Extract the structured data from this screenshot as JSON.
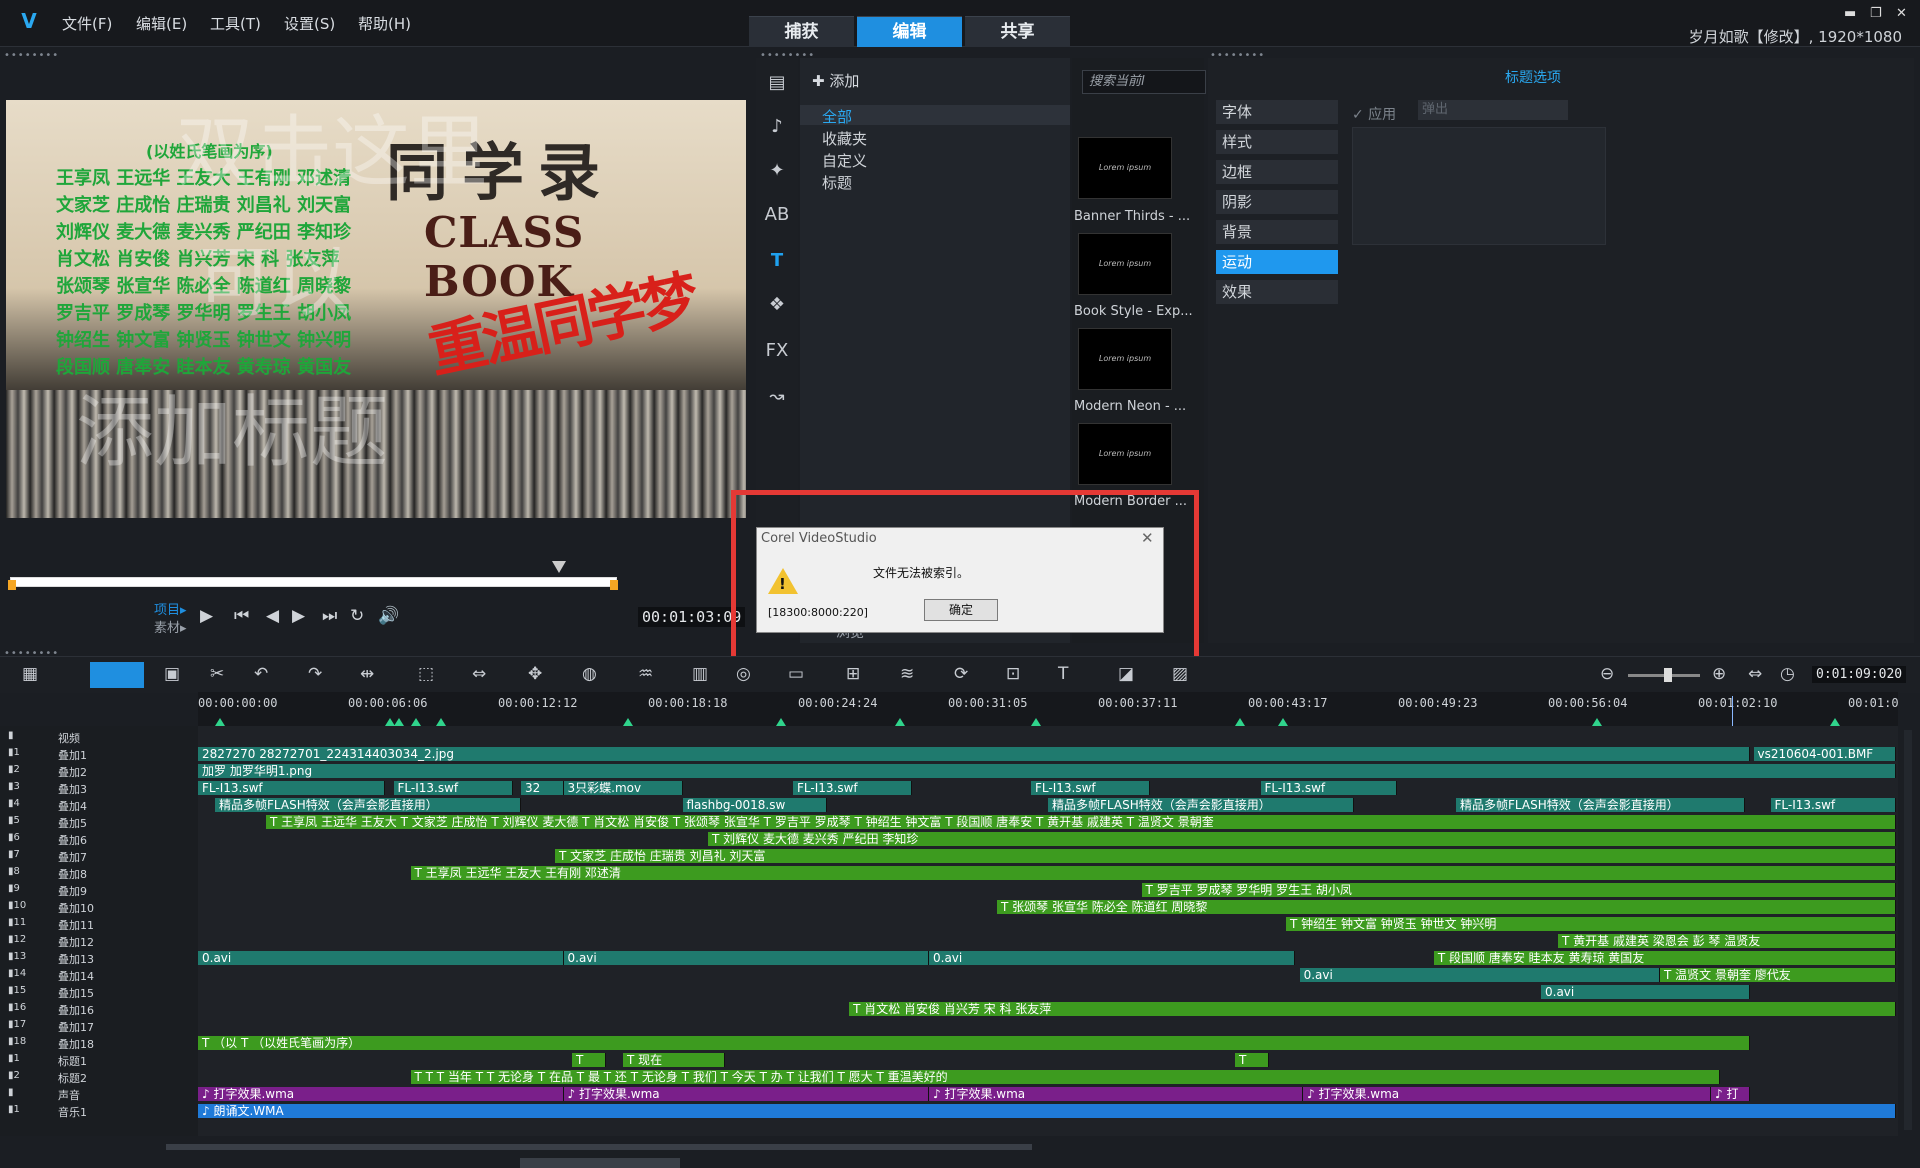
{
  "app": {
    "logo": "V",
    "menu": [
      "文件(F)",
      "编辑(E)",
      "工具(T)",
      "设置(S)",
      "帮助(H)"
    ],
    "tabs": [
      "捕获",
      "编辑",
      "共享"
    ],
    "active_tab": "编辑",
    "project_title": "岁月如歌【修改】, 1920*1080",
    "win_min": "▬",
    "win_max": "❐",
    "win_close": "✕"
  },
  "preview": {
    "scroll_title": "同学录",
    "classbook": "CLASS BOOK",
    "red_title": "重温同学梦",
    "names_header": "(以姓氏笔画为序)",
    "names": [
      "王享凤 王远华 王友大 王有刚 邓述清",
      "文家芝 庄成怡 庄瑞贵 刘昌礼 刘天富",
      "刘辉仪 麦大德 麦兴秀 严纪田 李知珍",
      "肖文松 肖安俊 肖兴芳 宋 科 张友萍",
      "张颂琴 张宣华 陈必全 陈道红 周晓黎",
      "罗吉平 罗成琴 罗华明 罗生王 胡小凤",
      "钟绍生 钟文富 钟贤玉 钟世文 钟兴明",
      "段国顺 唐奉安 眭本友 黄寿琼 黄国友"
    ],
    "watermark1": "双击这里",
    "watermark2": "可以",
    "watermark3": "添加标题",
    "project_label": "项目▸",
    "clip_label": "素材▸",
    "timecode": "00:01:03:09"
  },
  "playback": {
    "play": "▶",
    "start": "⏮",
    "prev": "◀",
    "next": "▶",
    "end": "⏭",
    "repeat": "↻",
    "volume": "🔊"
  },
  "library": {
    "add_label": "添加",
    "categories": [
      "全部",
      "收藏夹",
      "自定义",
      "标题"
    ],
    "selected_category": "全部",
    "search_placeholder": "搜索当前l",
    "thumbs": [
      {
        "caption": "Banner Thirds - ...",
        "text": "Lorem ipsum"
      },
      {
        "caption": "Book Style - Exp...",
        "text": "Lorem ipsum"
      },
      {
        "caption": "Modern Neon - ...",
        "text": "Lorem ipsum"
      },
      {
        "caption": "Modern Border ...",
        "text": "Lorem ipsum"
      }
    ],
    "tool_fx": "FX",
    "tool_title": "T",
    "tool_ab": "AB",
    "browse": "浏览"
  },
  "options": {
    "title": "标题选项",
    "items": [
      "字体",
      "样式",
      "边框",
      "阴影",
      "背景",
      "运动",
      "效果"
    ],
    "selected": "运动",
    "apply_label": "✓ 应用",
    "popup_value": "弹出"
  },
  "dialog": {
    "title": "Corel VideoStudio",
    "message": "文件无法被索引。",
    "code": "[18300:8000:220]",
    "ok_label": "确定",
    "close": "✕",
    "warn": "!"
  },
  "timeline": {
    "timecode": "0:01:09:020",
    "ticks": [
      "00:00:00:00",
      "00:00:06:06",
      "00:00:12:12",
      "00:00:18:18",
      "00:00:24:24",
      "00:00:31:05",
      "00:00:37:11",
      "00:00:43:17",
      "00:00:49:23",
      "00:00:56:04",
      "00:01:02:10",
      "00:01:0"
    ],
    "markers": [
      0.01,
      0.11,
      0.115,
      0.125,
      0.14,
      0.25,
      0.34,
      0.41,
      0.49,
      0.61,
      0.635,
      0.82,
      0.96
    ],
    "tracks": [
      "视频",
      "叠加1",
      "叠加2",
      "叠加3",
      "叠加4",
      "叠加5",
      "叠加6",
      "叠加7",
      "叠加8",
      "叠加9",
      "叠加10",
      "叠加11",
      "叠加12",
      "叠加13",
      "叠加14",
      "叠加15",
      "叠加16",
      "叠加17",
      "叠加18",
      "标题1",
      "标题2",
      "声音",
      "音乐1"
    ],
    "track_nums": [
      "",
      "1",
      "2",
      "3",
      "4",
      "5",
      "6",
      "7",
      "8",
      "9",
      "10",
      "11",
      "12",
      "13",
      "14",
      "15",
      "16",
      "17",
      "18",
      "1",
      "2",
      "",
      "1"
    ],
    "clips": [
      {
        "row": 1,
        "s": 0.0,
        "e": 0.913,
        "c": "c-teal",
        "t": "2827270  28272701_224314403034_2.jpg"
      },
      {
        "row": 1,
        "s": 0.915,
        "e": 0.999,
        "c": "c-teal",
        "t": "vs210604-001.BMF"
      },
      {
        "row": 2,
        "s": 0.0,
        "e": 0.999,
        "c": "c-teal",
        "t": "加罗  加罗华明1.png"
      },
      {
        "row": 3,
        "s": 0.0,
        "e": 0.11,
        "c": "c-teal",
        "t": "FL-I13.swf"
      },
      {
        "row": 3,
        "s": 0.115,
        "e": 0.185,
        "c": "c-teal",
        "t": "FL-I13.swf"
      },
      {
        "row": 3,
        "s": 0.19,
        "e": 0.215,
        "c": "c-teal",
        "t": "32"
      },
      {
        "row": 3,
        "s": 0.215,
        "e": 0.285,
        "c": "c-teal",
        "t": "3只彩蝶.mov"
      },
      {
        "row": 3,
        "s": 0.35,
        "e": 0.42,
        "c": "c-teal",
        "t": "FL-I13.swf"
      },
      {
        "row": 3,
        "s": 0.49,
        "e": 0.56,
        "c": "c-teal",
        "t": "FL-I13.swf"
      },
      {
        "row": 3,
        "s": 0.625,
        "e": 0.705,
        "c": "c-teal",
        "t": "FL-I13.swf"
      },
      {
        "row": 4,
        "s": 0.01,
        "e": 0.19,
        "c": "c-teal",
        "t": "精品多帧FLASH特效（会声会影直接用）"
      },
      {
        "row": 4,
        "s": 0.285,
        "e": 0.37,
        "c": "c-teal",
        "t": "flashbg-0018.sw"
      },
      {
        "row": 4,
        "s": 0.5,
        "e": 0.68,
        "c": "c-teal",
        "t": "精品多帧FLASH特效（会声会影直接用）"
      },
      {
        "row": 4,
        "s": 0.74,
        "e": 0.91,
        "c": "c-teal",
        "t": "精品多帧FLASH特效（会声会影直接用）"
      },
      {
        "row": 4,
        "s": 0.925,
        "e": 0.999,
        "c": "c-teal",
        "t": "FL-I13.swf"
      },
      {
        "row": 5,
        "s": 0.04,
        "e": 0.999,
        "c": "c-green",
        "t": "T  王享凤 王远华 王友大 T 文家芝 庄成怡  T 刘辉仪 麦大德  T 肖文松 肖安俊  T 张颂琴 张宣华  T 罗吉平 罗成琴  T 钟绍生 钟文富  T 段国顺 唐奉安  T 黄开基 戚建英  T 温贤文 景朝奎"
      },
      {
        "row": 6,
        "s": 0.3,
        "e": 0.999,
        "c": "c-green",
        "t": "T  刘辉仪 麦大德 麦兴秀 严纪田 李知珍"
      },
      {
        "row": 7,
        "s": 0.21,
        "e": 0.999,
        "c": "c-green",
        "t": "T  文家芝 庄成怡 庄瑞贵 刘昌礼 刘天富"
      },
      {
        "row": 8,
        "s": 0.125,
        "e": 0.999,
        "c": "c-green",
        "t": "T  王享凤 王远华 王友大 王有刚 邓述清"
      },
      {
        "row": 9,
        "s": 0.555,
        "e": 0.999,
        "c": "c-green",
        "t": "T  罗吉平 罗成琴 罗华明 罗生王 胡小凤"
      },
      {
        "row": 10,
        "s": 0.47,
        "e": 0.999,
        "c": "c-green",
        "t": "T  张颂琴 张宣华 陈必全 陈道红 周晓黎"
      },
      {
        "row": 11,
        "s": 0.64,
        "e": 0.999,
        "c": "c-green",
        "t": "T  钟绍生 钟文富 钟贤玉 钟世文 钟兴明"
      },
      {
        "row": 12,
        "s": 0.8,
        "e": 0.999,
        "c": "c-green",
        "t": "T  黄开基 戚建英 梁恩会 彭 琴 温贤友"
      },
      {
        "row": 13,
        "s": 0.0,
        "e": 0.215,
        "c": "c-teal",
        "t": "0.avi"
      },
      {
        "row": 13,
        "s": 0.215,
        "e": 0.43,
        "c": "c-teal",
        "t": "0.avi"
      },
      {
        "row": 13,
        "s": 0.43,
        "e": 0.645,
        "c": "c-teal",
        "t": "0.avi"
      },
      {
        "row": 13,
        "s": 0.727,
        "e": 0.999,
        "c": "c-green",
        "t": "T  段国顺 唐奉安 眭本友 黄寿琼 黄国友"
      },
      {
        "row": 14,
        "s": 0.648,
        "e": 0.86,
        "c": "c-teal",
        "t": "0.avi"
      },
      {
        "row": 14,
        "s": 0.86,
        "e": 0.999,
        "c": "c-green",
        "t": "T  温贤文 景朝奎 廖代友"
      },
      {
        "row": 15,
        "s": 0.79,
        "e": 0.913,
        "c": "c-teal",
        "t": "0.avi"
      },
      {
        "row": 16,
        "s": 0.383,
        "e": 0.999,
        "c": "c-green",
        "t": "T  肖文松 肖安俊 肖兴芳 宋 科 张友萍"
      },
      {
        "row": 18,
        "s": 0.0,
        "e": 0.913,
        "c": "c-green",
        "t": "T （以 T （以姓氏笔画为序）"
      },
      {
        "row": 19,
        "s": 0.22,
        "e": 0.24,
        "c": "c-green",
        "t": "T"
      },
      {
        "row": 19,
        "s": 0.25,
        "e": 0.31,
        "c": "c-green",
        "t": "T  现在"
      },
      {
        "row": 19,
        "s": 0.61,
        "e": 0.63,
        "c": "c-green",
        "t": "T"
      },
      {
        "row": 20,
        "s": 0.125,
        "e": 0.895,
        "c": "c-green",
        "t": "T  T  T 当年  T  T 无论身  T 在品  T 最  T 还  T 无论身  T 我们  T 今天  T 办  T 让我们  T 愿大  T 重温美好的"
      },
      {
        "row": 21,
        "s": 0.0,
        "e": 0.215,
        "c": "c-purple",
        "t": "♪ 打字效果.wma"
      },
      {
        "row": 21,
        "s": 0.215,
        "e": 0.43,
        "c": "c-purple",
        "t": "♪ 打字效果.wma"
      },
      {
        "row": 21,
        "s": 0.43,
        "e": 0.65,
        "c": "c-purple",
        "t": "♪ 打字效果.wma"
      },
      {
        "row": 21,
        "s": 0.65,
        "e": 0.89,
        "c": "c-purple",
        "t": "♪ 打字效果.wma"
      },
      {
        "row": 21,
        "s": 0.89,
        "e": 0.913,
        "c": "c-purple",
        "t": "♪ 打"
      },
      {
        "row": 22,
        "s": 0.0,
        "e": 0.999,
        "c": "c-blue",
        "t": "♪ 朗诵文.WMA"
      }
    ]
  },
  "colors": {
    "accent": "#1f8fe0",
    "teal": "#1f7a6e",
    "green": "#3d9b1f",
    "purple": "#7a1f8a",
    "dialog_frame": "#e53935"
  }
}
